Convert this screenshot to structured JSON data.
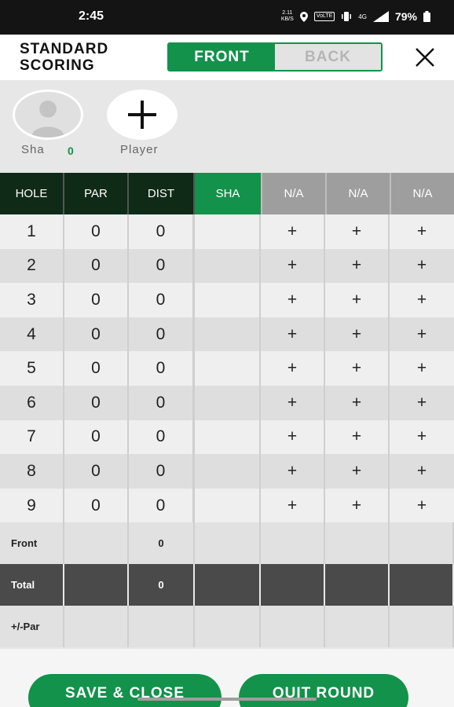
{
  "status_bar": {
    "time": "2:45",
    "speed_value": "2.11",
    "speed_unit": "KB/S",
    "volte": "VoLTE",
    "network": "4G",
    "battery": "79%"
  },
  "header": {
    "title": "STANDARD SCORING",
    "tabs": {
      "front": "FRONT",
      "back": "BACK"
    },
    "active_tab": "FRONT"
  },
  "players": {
    "player1": {
      "name": "Sha",
      "score": "0"
    },
    "add_label": "Player"
  },
  "table": {
    "headers": {
      "hole": "HOLE",
      "par": "PAR",
      "dist": "DIST",
      "p1": "SHA",
      "p2": "N/A",
      "p3": "N/A",
      "p4": "N/A"
    },
    "rows": [
      {
        "hole": "1",
        "par": "0",
        "dist": "0",
        "p1": "",
        "p2": "+",
        "p3": "+",
        "p4": "+"
      },
      {
        "hole": "2",
        "par": "0",
        "dist": "0",
        "p1": "",
        "p2": "+",
        "p3": "+",
        "p4": "+"
      },
      {
        "hole": "3",
        "par": "0",
        "dist": "0",
        "p1": "",
        "p2": "+",
        "p3": "+",
        "p4": "+"
      },
      {
        "hole": "4",
        "par": "0",
        "dist": "0",
        "p1": "",
        "p2": "+",
        "p3": "+",
        "p4": "+"
      },
      {
        "hole": "5",
        "par": "0",
        "dist": "0",
        "p1": "",
        "p2": "+",
        "p3": "+",
        "p4": "+"
      },
      {
        "hole": "6",
        "par": "0",
        "dist": "0",
        "p1": "",
        "p2": "+",
        "p3": "+",
        "p4": "+"
      },
      {
        "hole": "7",
        "par": "0",
        "dist": "0",
        "p1": "",
        "p2": "+",
        "p3": "+",
        "p4": "+"
      },
      {
        "hole": "8",
        "par": "0",
        "dist": "0",
        "p1": "",
        "p2": "+",
        "p3": "+",
        "p4": "+"
      },
      {
        "hole": "9",
        "par": "0",
        "dist": "0",
        "p1": "",
        "p2": "+",
        "p3": "+",
        "p4": "+"
      }
    ],
    "front": {
      "label": "Front",
      "dist": "0"
    },
    "total": {
      "label": "Total",
      "dist": "0"
    },
    "par_diff": {
      "label": "+/-Par"
    }
  },
  "footer": {
    "save_close": "SAVE & CLOSE",
    "quit_round": "QUIT ROUND"
  },
  "colors": {
    "accent_green": "#12924a",
    "header_dark": "#0f2a17",
    "na_gray": "#9e9e9e",
    "total_row": "#4a4a4a"
  },
  "icons": {
    "close": "close-icon",
    "avatar": "person-avatar-icon",
    "add_player": "plus-icon"
  }
}
